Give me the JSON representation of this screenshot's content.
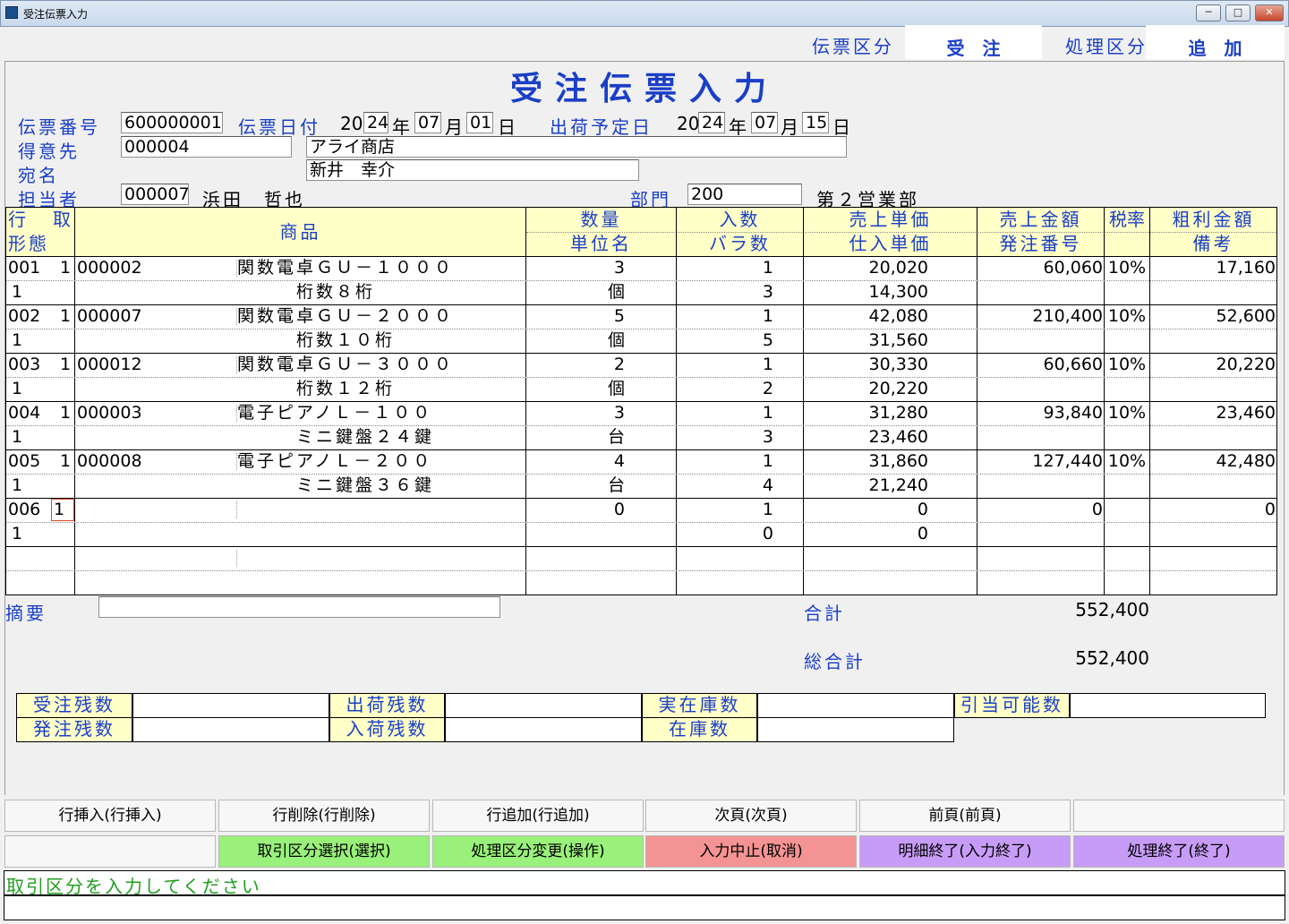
{
  "window": {
    "title": "受注伝票入力",
    "minimize": "─",
    "maximize": "□",
    "close": "✕"
  },
  "header": {
    "slip_kind_label": "伝票区分",
    "slip_kind_value": "受　注",
    "process_kind_label": "処理区分",
    "process_kind_value": "追　加",
    "page_title": "受注伝票入力"
  },
  "form": {
    "slip_no_label": "伝票番号",
    "slip_no": "600000001",
    "slip_date_label": "伝票日付",
    "slip_date_prefix": "20",
    "slip_year": "24",
    "year_label": "年",
    "slip_month": "07",
    "month_label": "月",
    "slip_day": "01",
    "day_label": "日",
    "ship_date_label": "出荷予定日",
    "ship_date_prefix": "20",
    "ship_year": "24",
    "ship_month": "07",
    "ship_day": "15",
    "customer_label": "得意先",
    "customer_code": "000004",
    "customer_name": "アライ商店",
    "addressee_label": "宛名",
    "addressee": "新井　幸介",
    "staff_label": "担当者",
    "staff_code": "000007",
    "staff_name": "浜田　哲也",
    "dept_label": "部門",
    "dept_code": "200",
    "dept_name": "第２営業部"
  },
  "table": {
    "headers": {
      "line": "行",
      "torihiki": "取",
      "form": "形態",
      "product": "商品",
      "qty": "数量",
      "unit": "単位名",
      "irisu": "入数",
      "bara": "バラ数",
      "sale_price": "売上単価",
      "cost_price": "仕入単価",
      "sale_amount": "売上金額",
      "po_no": "発注番号",
      "tax": "税率",
      "profit": "粗利金額",
      "note": "備考"
    },
    "rows": [
      {
        "line": "001",
        "kbn": "1",
        "form": "1",
        "code": "000002",
        "name": "関数電卓ＧＵ－１０００",
        "spec": "桁数８桁",
        "qty": "3",
        "unit": "個",
        "irisu": "1",
        "bara": "3",
        "sale_price": "20,020",
        "cost_price": "14,300",
        "amount": "60,060",
        "po": "",
        "tax": "10%",
        "profit": "17,160",
        "note": ""
      },
      {
        "line": "002",
        "kbn": "1",
        "form": "1",
        "code": "000007",
        "name": "関数電卓ＧＵ－２０００",
        "spec": "桁数１０桁",
        "qty": "5",
        "unit": "個",
        "irisu": "1",
        "bara": "5",
        "sale_price": "42,080",
        "cost_price": "31,560",
        "amount": "210,400",
        "po": "",
        "tax": "10%",
        "profit": "52,600",
        "note": ""
      },
      {
        "line": "003",
        "kbn": "1",
        "form": "1",
        "code": "000012",
        "name": "関数電卓ＧＵ－３０００",
        "spec": "桁数１２桁",
        "qty": "2",
        "unit": "個",
        "irisu": "1",
        "bara": "2",
        "sale_price": "30,330",
        "cost_price": "20,220",
        "amount": "60,660",
        "po": "",
        "tax": "10%",
        "profit": "20,220",
        "note": ""
      },
      {
        "line": "004",
        "kbn": "1",
        "form": "1",
        "code": "000003",
        "name": "電子ピアノＬ－１００",
        "spec": "ミニ鍵盤２４鍵",
        "qty": "3",
        "unit": "台",
        "irisu": "1",
        "bara": "3",
        "sale_price": "31,280",
        "cost_price": "23,460",
        "amount": "93,840",
        "po": "",
        "tax": "10%",
        "profit": "23,460",
        "note": ""
      },
      {
        "line": "005",
        "kbn": "1",
        "form": "1",
        "code": "000008",
        "name": "電子ピアノＬ－２００",
        "spec": "ミニ鍵盤３６鍵",
        "qty": "4",
        "unit": "台",
        "irisu": "1",
        "bara": "4",
        "sale_price": "31,860",
        "cost_price": "21,240",
        "amount": "127,440",
        "po": "",
        "tax": "10%",
        "profit": "42,480",
        "note": ""
      },
      {
        "line": "006",
        "kbn": "1",
        "form": "1",
        "code": "",
        "name": "",
        "spec": "",
        "qty": "0",
        "unit": "",
        "irisu": "1",
        "bara": "0",
        "sale_price": "0",
        "cost_price": "0",
        "amount": "0",
        "po": "",
        "tax": "",
        "profit": "0",
        "note": ""
      }
    ]
  },
  "summary": {
    "memo_label": "摘要",
    "memo": "",
    "total_label": "合計",
    "total": "552,400",
    "grand_total_label": "総合計",
    "grand_total": "552,400"
  },
  "stock": {
    "order_remain": "受注残数",
    "ship_remain": "出荷残数",
    "actual_stock": "実在庫数",
    "allocatable": "引当可能数",
    "po_remain": "発注残数",
    "receive_remain": "入荷残数",
    "stock": "在庫数"
  },
  "buttons": {
    "insert_row": "行挿入(行挿入)",
    "delete_row": "行削除(行削除)",
    "add_row": "行追加(行追加)",
    "next_page": "次頁(次頁)",
    "prev_page": "前頁(前頁)",
    "select_kbn": "取引区分選択(選択)",
    "change_process": "処理区分変更(操作)",
    "cancel_input": "入力中止(取消)",
    "end_detail": "明細終了(入力終了)",
    "end_process": "処理終了(終了)"
  },
  "status": {
    "message": "取引区分を入力してください"
  }
}
